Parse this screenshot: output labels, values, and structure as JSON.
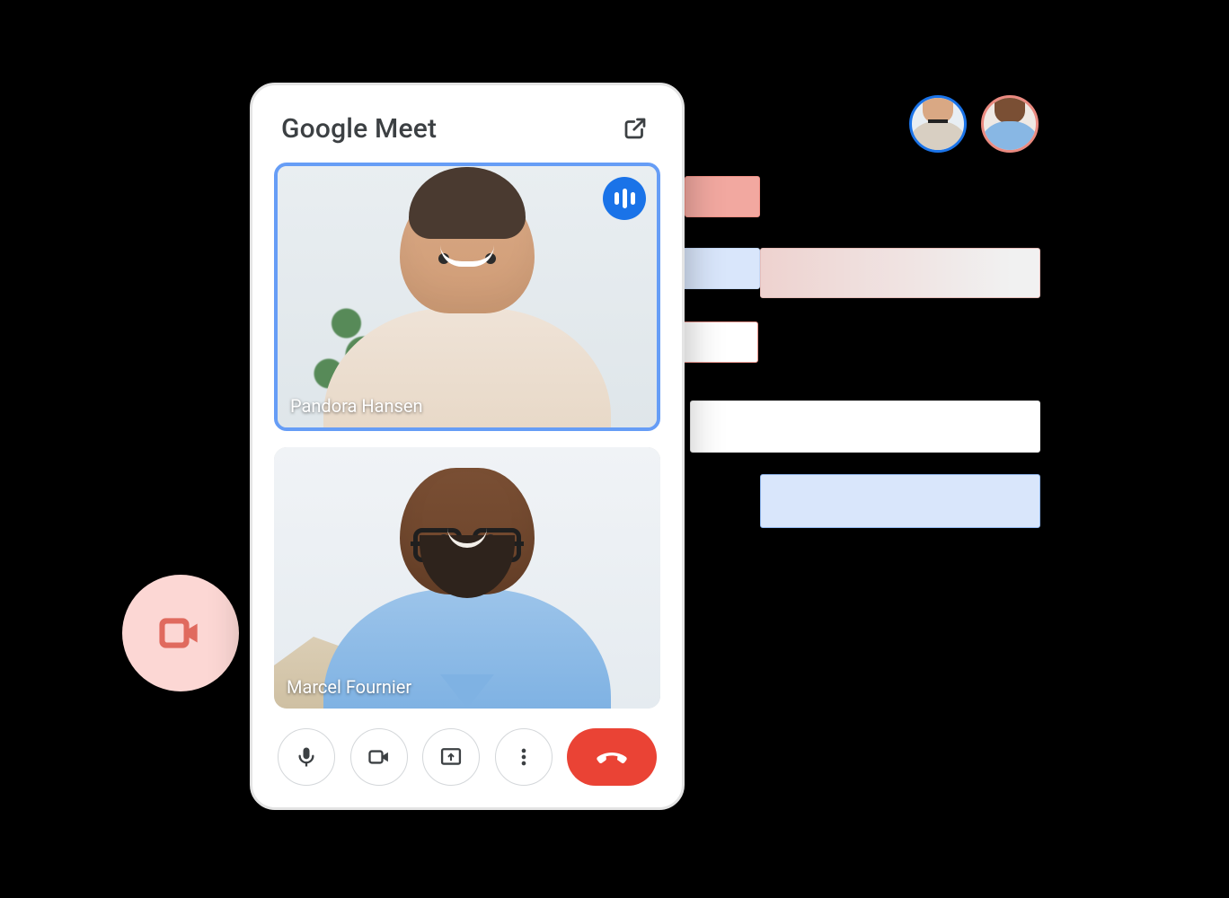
{
  "meet": {
    "title": "Google Meet",
    "participants": [
      {
        "name": "Pandora Hansen",
        "is_speaking": true
      },
      {
        "name": "Marcel Fournier",
        "is_speaking": false
      }
    ],
    "controls": {
      "mic": "microphone-icon",
      "camera": "video-icon",
      "present": "present-screen-icon",
      "more": "more-options-icon",
      "hangup": "hang-up-icon",
      "popout": "open-in-new-icon"
    }
  },
  "floating_action": {
    "icon": "video-icon",
    "color": "#e06a5e",
    "bg": "#fcd7d4"
  },
  "calendar_preview": {
    "avatars": [
      {
        "ref_participant": "Pandora Hansen",
        "ring": "#1a73e8"
      },
      {
        "ref_participant": "Marcel Fournier",
        "ring": "#ea8a80"
      }
    ],
    "blocks": [
      {
        "color": "#f2a8a0"
      },
      {
        "color": "#d9e6fb"
      },
      {
        "color": "#fbdedb"
      },
      {
        "color": "#ffffff",
        "border": "#e6938b"
      },
      {
        "color": "#ffffff"
      },
      {
        "color": "#d9e6fb",
        "border": "#93b9ef"
      }
    ]
  },
  "colors": {
    "google_blue": "#1a73e8",
    "google_red": "#ea4335",
    "tile_active_border": "#669df6"
  }
}
